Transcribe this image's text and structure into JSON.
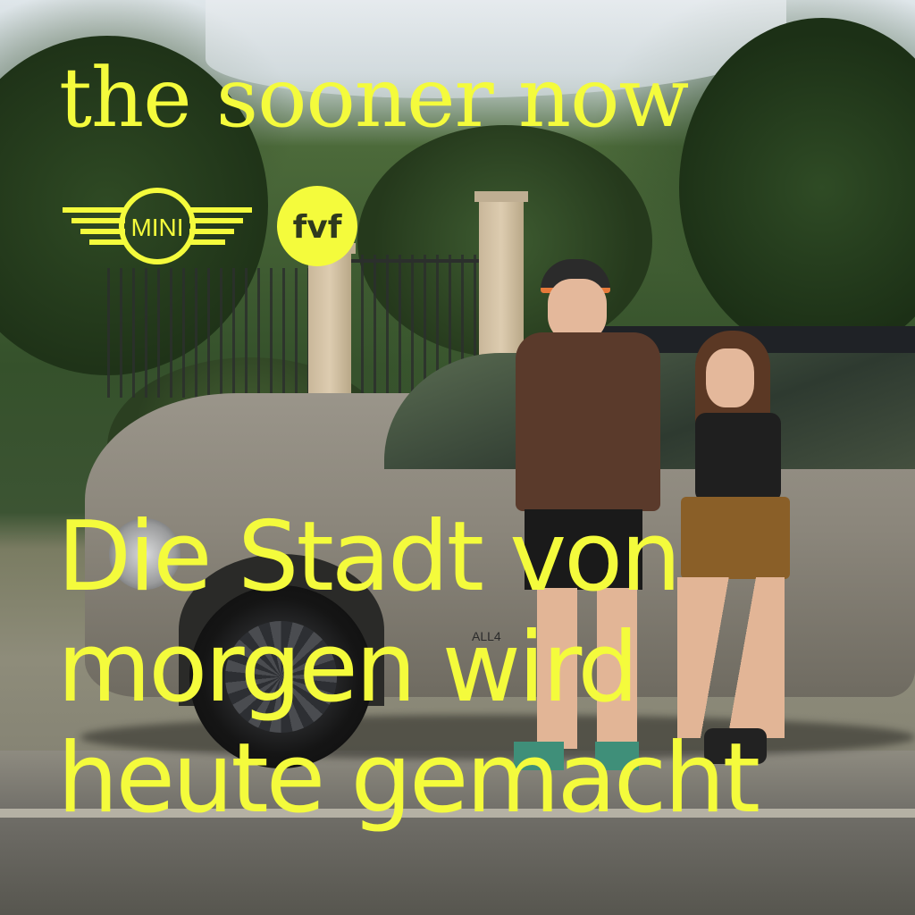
{
  "poster": {
    "title": "the sooner now",
    "logos": {
      "mini": {
        "label": "MINI",
        "icon": "mini-wings-logo"
      },
      "fvf": {
        "label": "fvf",
        "icon": "fvf-circle-logo"
      }
    },
    "headline": {
      "line1": "Die Stadt von",
      "line2": "morgen wird",
      "line3": "heute gemacht"
    },
    "badge_on_car": "ALL4",
    "accent_color": "#f4fb3c"
  }
}
